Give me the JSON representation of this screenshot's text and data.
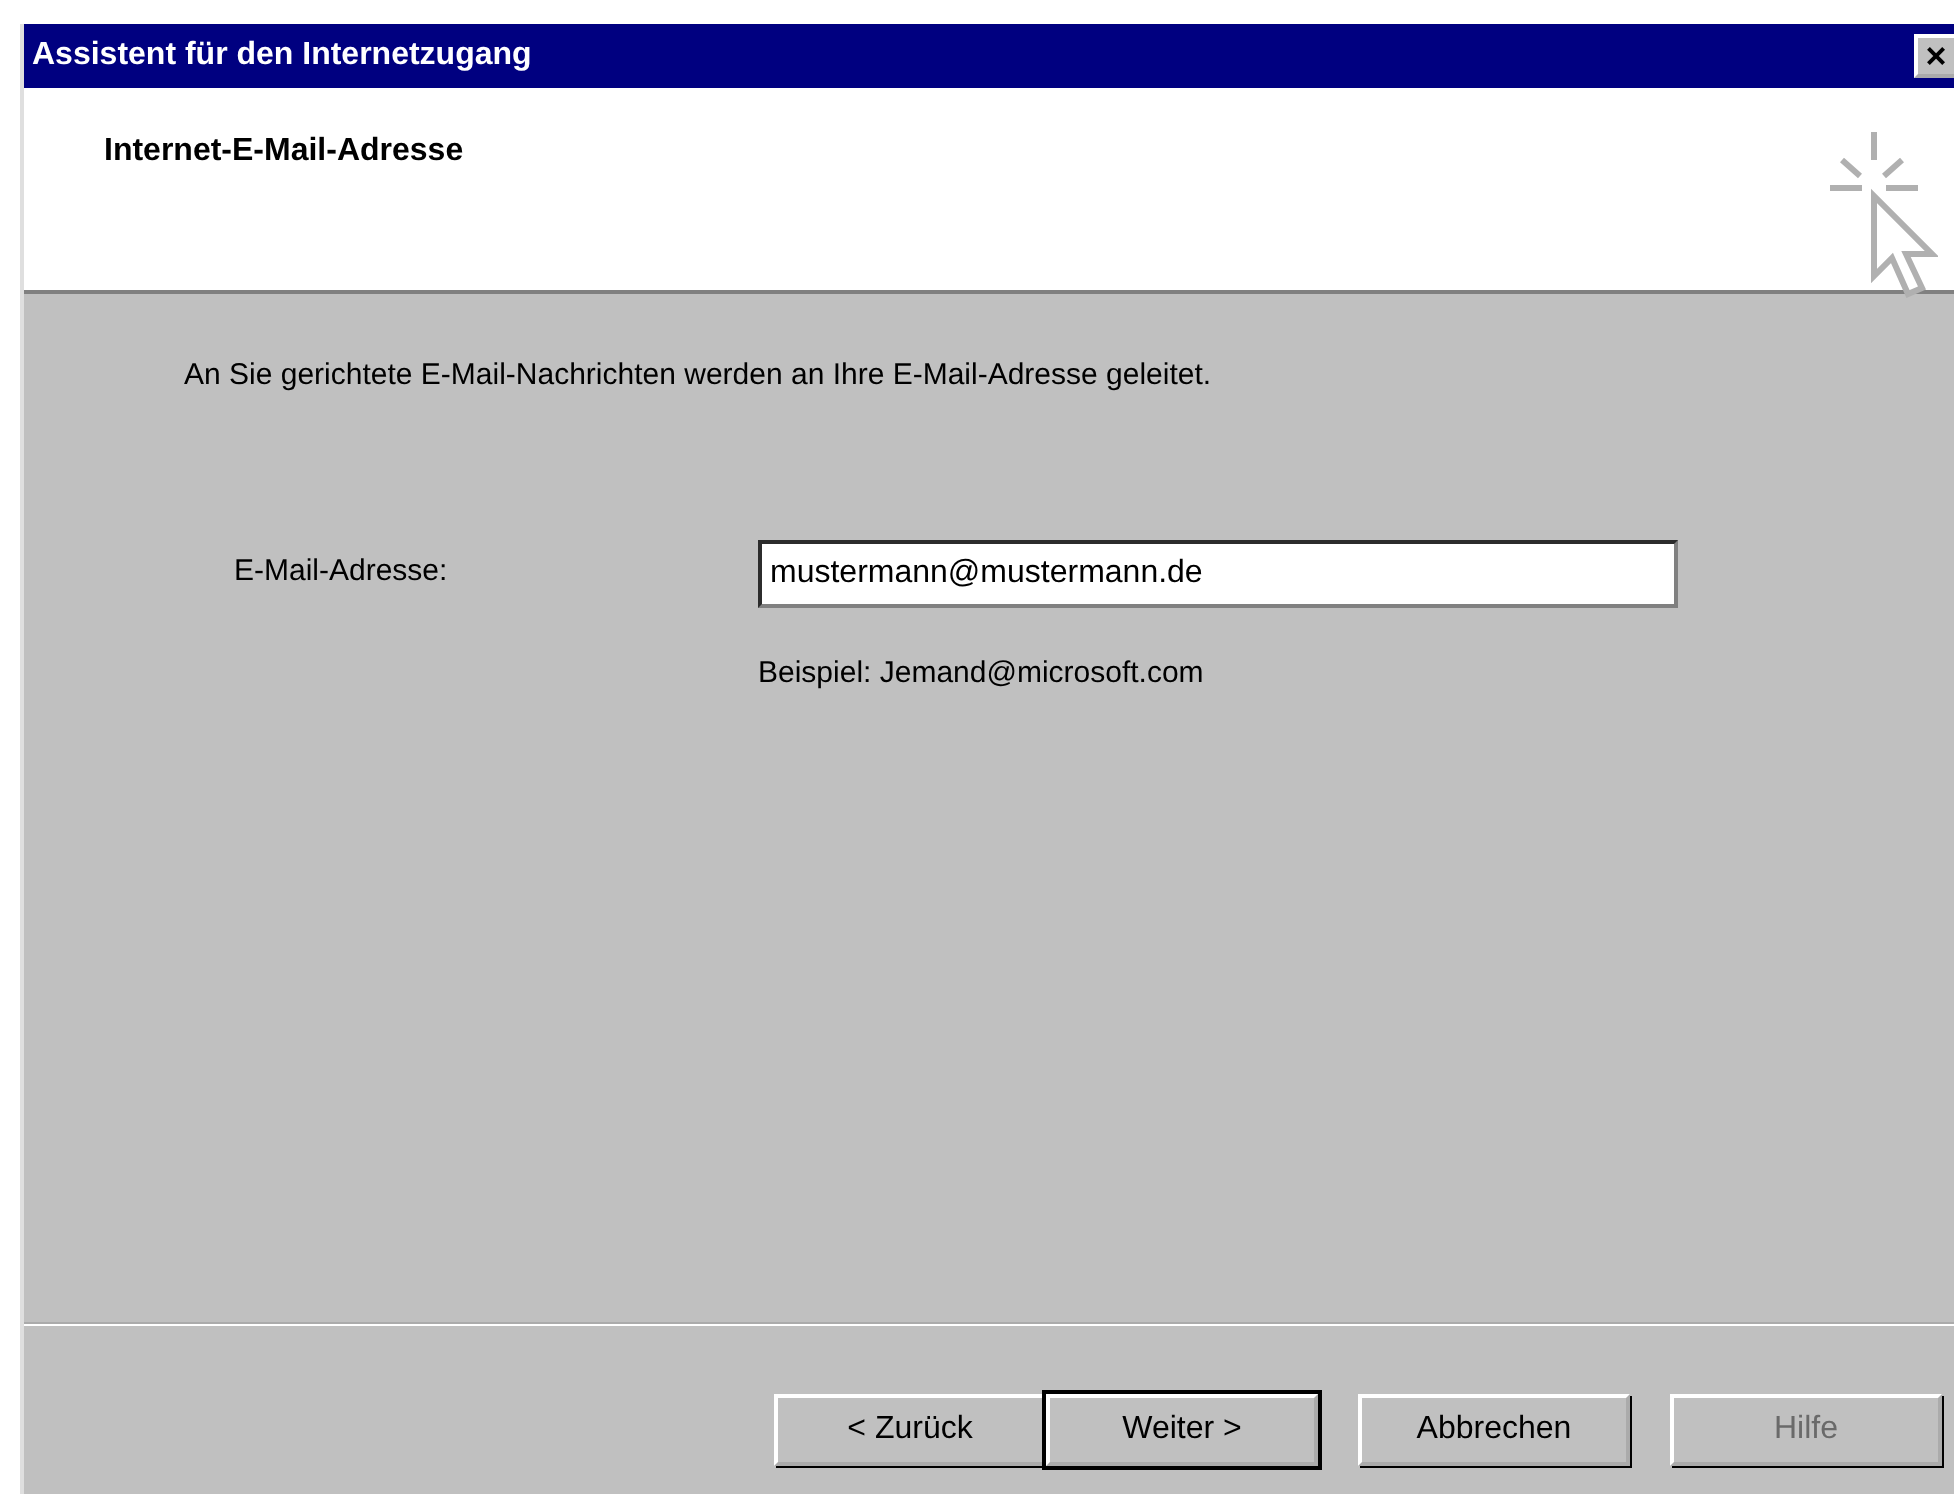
{
  "window": {
    "title": "Assistent für den Internetzugang",
    "close_label": "×"
  },
  "header": {
    "title": "Internet-E-Mail-Adresse"
  },
  "intro": "An Sie gerichtete E-Mail-Nachrichten werden an Ihre E-Mail-Adresse geleitet.",
  "email": {
    "label": "E-Mail-Adresse:",
    "value": "mustermann@mustermann.de",
    "hint": "Beispiel: Jemand@microsoft.com"
  },
  "buttons": [
    {
      "label": "< Zurück",
      "default": false,
      "disabled": false
    },
    {
      "label": "Weiter >",
      "default": true,
      "disabled": false
    },
    {
      "label": "Abbrechen",
      "default": false,
      "disabled": false
    },
    {
      "label": "Hilfe",
      "default": false,
      "disabled": true
    }
  ]
}
